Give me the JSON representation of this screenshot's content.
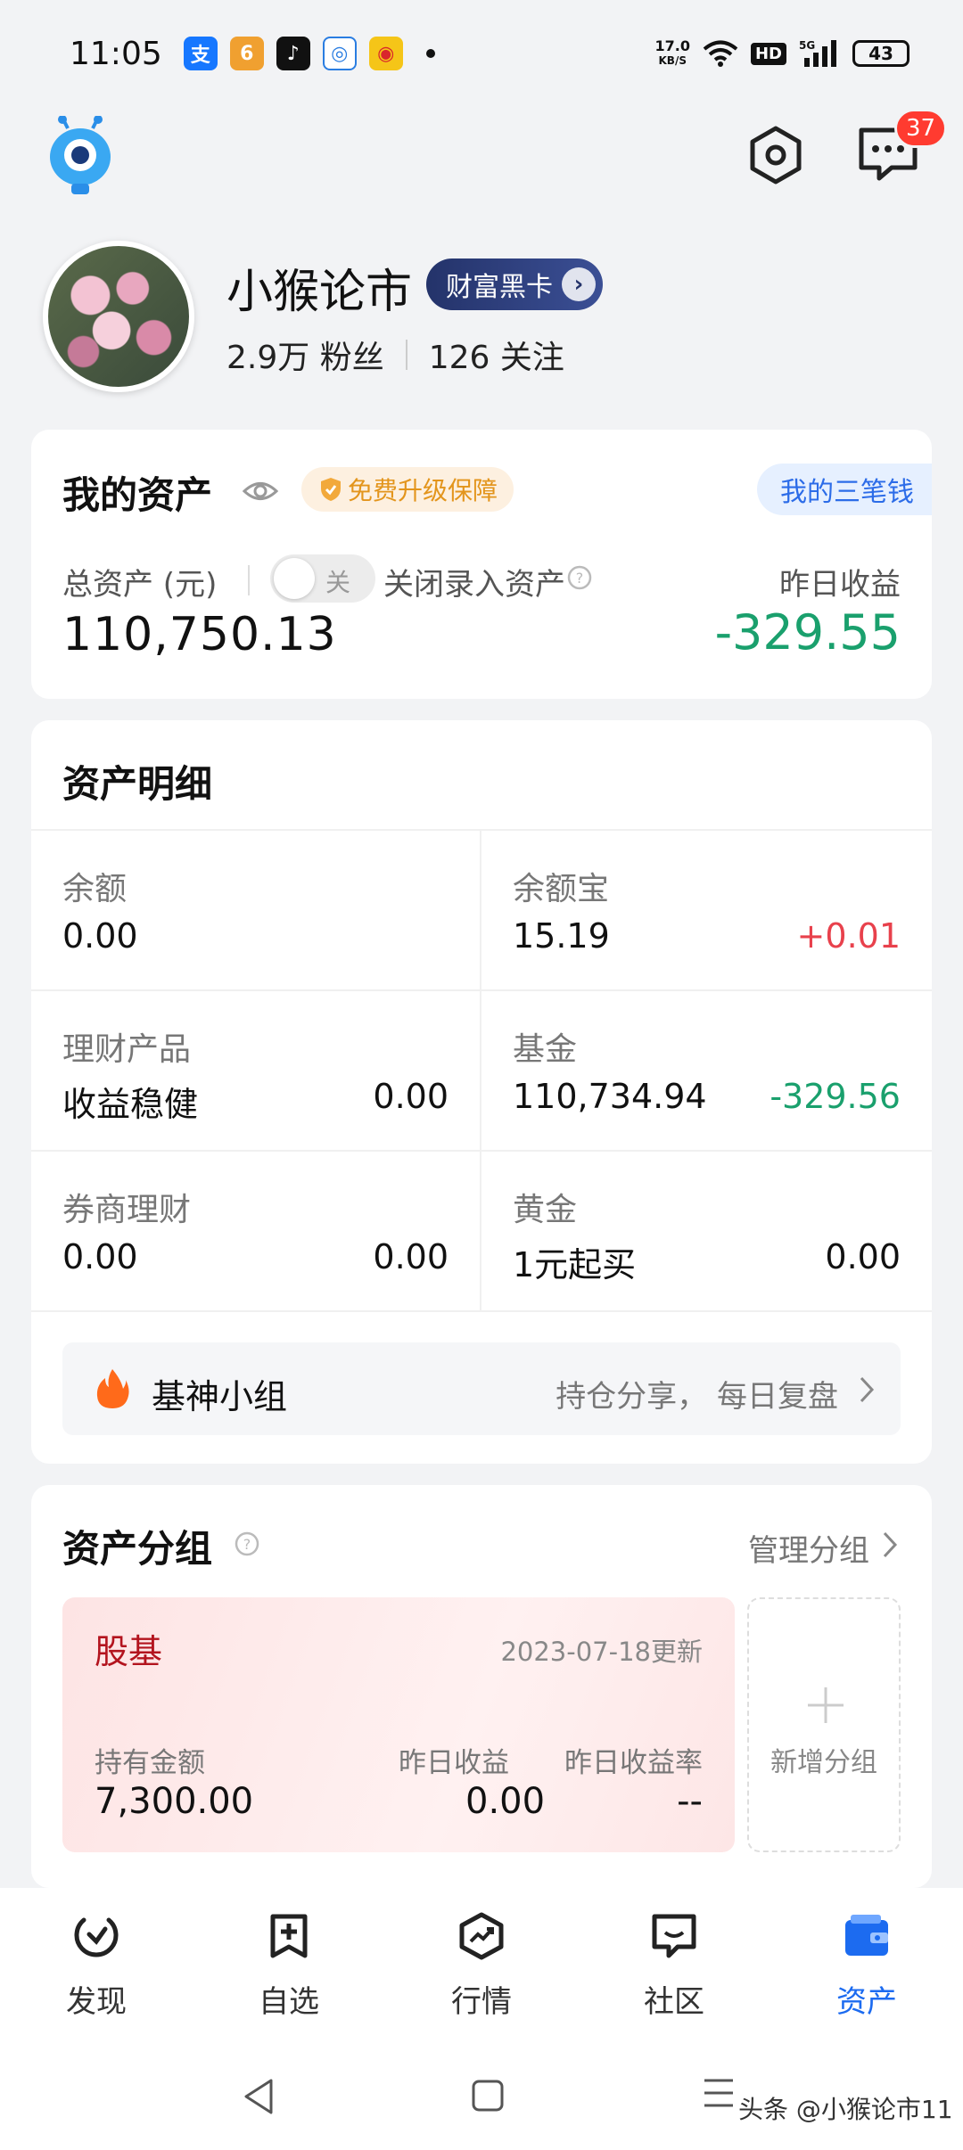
{
  "status_bar": {
    "time": "11:05",
    "speed_value": "17.0",
    "speed_unit": "KB/S",
    "network": "5G",
    "hd": "HD",
    "battery": "43"
  },
  "header": {
    "message_badge": "37"
  },
  "profile": {
    "name": "小猴论市",
    "vip_label": "财富黑卡",
    "fans": "2.9万 粉丝",
    "following": "126 关注"
  },
  "assets_card": {
    "title": "我的资产",
    "protect_label": "免费升级保障",
    "three_money": "我的三笔钱",
    "total_label": "总资产 (元)",
    "toggle_text": "关",
    "close_entry": "关闭录入资产",
    "total_value": "110,750.13",
    "yesterday_label": "昨日收益",
    "yesterday_value": "-329.55"
  },
  "detail_card": {
    "title": "资产明细",
    "cells": [
      {
        "label": "余额",
        "value": "0.00",
        "right": ""
      },
      {
        "label": "余额宝",
        "value": "15.19",
        "right": "+0.01"
      },
      {
        "label": "理财产品",
        "value": "收益稳健",
        "right": "0.00"
      },
      {
        "label": "基金",
        "value": "110,734.94",
        "right": "-329.56"
      },
      {
        "label": "券商理财",
        "value": "0.00",
        "right": "0.00"
      },
      {
        "label": "黄金",
        "value": "1元起买",
        "right": "0.00"
      }
    ],
    "group_banner": {
      "title": "基神小组",
      "desc": "持仓分享， 每日复盘"
    }
  },
  "groups_card": {
    "title": "资产分组",
    "manage": "管理分组",
    "group": {
      "name": "股基",
      "date": "2023-07-18更新",
      "hold_label": "持有金额",
      "hold_value": "7,300.00",
      "yesterday_label": "昨日收益",
      "yesterday_value": "0.00",
      "rate_label": "昨日收益率",
      "rate_value": "--"
    },
    "add_label": "新增分组"
  },
  "tabbar": {
    "tabs": [
      {
        "label": "发现",
        "icon": "discover-icon"
      },
      {
        "label": "自选",
        "icon": "watchlist-icon"
      },
      {
        "label": "行情",
        "icon": "market-icon"
      },
      {
        "label": "社区",
        "icon": "community-icon"
      },
      {
        "label": "资产",
        "icon": "wallet-icon"
      }
    ]
  },
  "watermark": "头条 @小猴论市11",
  "colors": {
    "accent_blue": "#1c6bf0",
    "loss_green": "#1aa06d",
    "gain_red": "#e8414c",
    "group_red": "#b3141e"
  }
}
